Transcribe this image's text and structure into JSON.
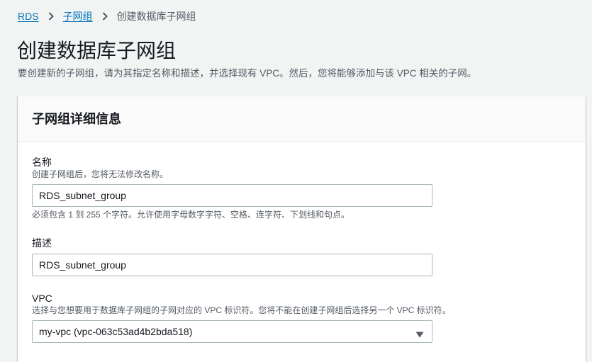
{
  "breadcrumb": {
    "items": [
      "RDS",
      "子网组"
    ],
    "current": "创建数据库子网组"
  },
  "page": {
    "title": "创建数据库子网组",
    "description": "要创建新的子网组，请为其指定名称和描述，并选择现有 VPC。然后，您将能够添加与该 VPC 相关的子网。"
  },
  "section": {
    "title": "子网组详细信息",
    "name_field": {
      "label": "名称",
      "description": "创建子网组后，您将无法修改名称。",
      "value": "RDS_subnet_group",
      "constraint": "必须包含 1 到 255 个字符。允许使用字母数字字符、空格、连字符、下划线和句点。"
    },
    "description_field": {
      "label": "描述",
      "value": "RDS_subnet_group"
    },
    "vpc_field": {
      "label": "VPC",
      "description": "选择与您想要用于数据库子网组的子网对应的 VPC 标识符。您将不能在创建子网组后选择另一个 VPC 标识符。",
      "selected": "my-vpc (vpc-063c53ad4b2bda518)"
    }
  },
  "colors": {
    "link": "#0073bb",
    "background": "#f2f3f3",
    "text": "#16191f",
    "muted": "#545b64",
    "border": "#aab7b8"
  },
  "icons": {
    "breadcrumb_separator": "chevron-right-icon",
    "select_caret": "caret-down-icon"
  }
}
